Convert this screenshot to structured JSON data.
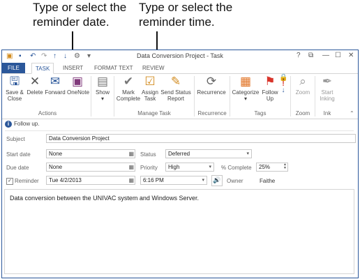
{
  "callouts": {
    "date": "Type or select the\nreminder date.",
    "time": "Type or select the\nreminder time."
  },
  "window": {
    "title": "Data Conversion Project - Task",
    "help": "?",
    "restore": "⧉",
    "minimize": "—",
    "maximize": "☐",
    "close": "✕"
  },
  "tabs": [
    "FILE",
    "TASK",
    "INSERT",
    "FORMAT TEXT",
    "REVIEW"
  ],
  "ribbon": {
    "buttons": [
      {
        "label": "Save &\nClose",
        "icon": "save-close-icon"
      },
      {
        "label": "Delete",
        "icon": "delete-icon"
      },
      {
        "label": "Forward",
        "icon": "forward-icon"
      },
      {
        "label": "OneNote",
        "icon": "onenote-icon"
      },
      {
        "label": "Show",
        "icon": "show-icon"
      },
      {
        "label": "Mark\nComplete",
        "icon": "checkmark-icon"
      },
      {
        "label": "Assign\nTask",
        "icon": "assign-task-icon"
      },
      {
        "label": "Send Status\nReport",
        "icon": "send-status-report-icon"
      },
      {
        "label": "Recurrence",
        "icon": "recurrence-icon"
      },
      {
        "label": "Categorize",
        "icon": "categorize-icon"
      },
      {
        "label": "Follow\nUp",
        "icon": "follow-up-flag-icon"
      },
      {
        "label": "Zoom",
        "icon": "zoom-icon"
      },
      {
        "label": "Start\nInking",
        "icon": "pen-icon"
      }
    ],
    "groups": [
      "Actions",
      "Manage Task",
      "Recurrence",
      "Tags",
      "Zoom",
      "Ink"
    ]
  },
  "infobar": "Follow up.",
  "form": {
    "subject_label": "Subject",
    "subject_value": "Data Conversion Project",
    "start_label": "Start date",
    "start_value": "None",
    "due_label": "Due date",
    "due_value": "None",
    "status_label": "Status",
    "status_value": "Deferred",
    "priority_label": "Priority",
    "priority_value": "High",
    "complete_label": "% Complete",
    "complete_value": "25%",
    "reminder_label": "Reminder",
    "reminder_checked": true,
    "reminder_date": "Tue 4/2/2013",
    "reminder_time": "6:16 PM",
    "owner_label": "Owner",
    "owner_value": "Faithe"
  },
  "body_text": "Data conversion between the UNIVAC system and Windows Server."
}
